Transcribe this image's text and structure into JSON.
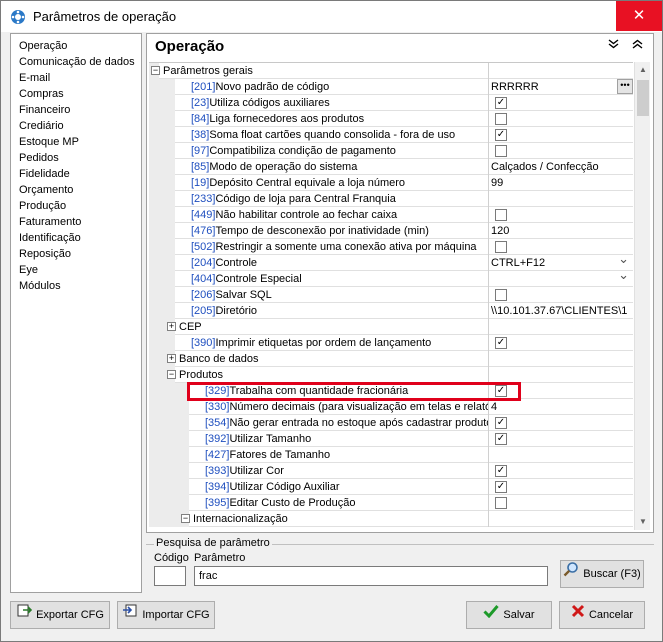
{
  "window": {
    "title": "Parâmetros de operação"
  },
  "nav": [
    "Operação",
    "Comunicação de dados",
    "E-mail",
    "Compras",
    "Financeiro",
    "Crediário",
    "Estoque MP",
    "Pedidos",
    "Fidelidade",
    "Orçamento",
    "Produção",
    "Faturamento",
    "Identificação",
    "Reposição",
    "Eye",
    "Módulos"
  ],
  "panel": {
    "title": "Operação"
  },
  "rows": [
    {
      "level": 0,
      "expander": "minus",
      "name": "Parâmetros gerais",
      "group": true
    },
    {
      "level": 1,
      "code": "[201]",
      "name": "Novo padrão de código",
      "value": "RRRRRR",
      "type": "ellipsis"
    },
    {
      "level": 1,
      "code": "[23]",
      "name": "Utiliza códigos auxiliares",
      "check": "✓",
      "type": "check"
    },
    {
      "level": 1,
      "code": "[84]",
      "name": "Liga fornecedores aos produtos",
      "check": "",
      "type": "check"
    },
    {
      "level": 1,
      "code": "[38]",
      "name": "Soma float cartões quando consolida - fora de uso",
      "check": "✓",
      "type": "check"
    },
    {
      "level": 1,
      "code": "[97]",
      "name": "Compatibiliza condição de pagamento",
      "check": "",
      "type": "check"
    },
    {
      "level": 1,
      "code": "[85]",
      "name": "Modo de operação do sistema",
      "value": "Calçados / Confecção",
      "type": "text"
    },
    {
      "level": 1,
      "code": "[19]",
      "name": "Depósito Central equivale a loja número",
      "value": "99",
      "type": "text"
    },
    {
      "level": 1,
      "code": "[233]",
      "name": "Código de loja para Central Franquia",
      "value": "",
      "type": "text"
    },
    {
      "level": 1,
      "code": "[449]",
      "name": "Não habilitar controle ao fechar caixa",
      "check": "",
      "type": "check"
    },
    {
      "level": 1,
      "code": "[476]",
      "name": "Tempo de desconexão por inatividade (min)",
      "value": "120",
      "type": "text"
    },
    {
      "level": 1,
      "code": "[502]",
      "name": "Restringir a somente uma conexão ativa por máquina",
      "check": "",
      "type": "check"
    },
    {
      "level": 1,
      "code": "[204]",
      "name": "Controle",
      "value": "CTRL+F12",
      "type": "dropdown"
    },
    {
      "level": 1,
      "code": "[404]",
      "name": "Controle Especial",
      "value": "",
      "type": "dropdown"
    },
    {
      "level": 1,
      "code": "[206]",
      "name": "Salvar SQL",
      "check": "",
      "type": "check"
    },
    {
      "level": 1,
      "code": "[205]",
      "name": "Diretório",
      "value": "\\\\10.101.37.67\\CLIENTES\\1",
      "type": "text"
    },
    {
      "level": 1,
      "expander": "plus",
      "name": "CEP",
      "group": true
    },
    {
      "level": 1,
      "code": "[390]",
      "name": "Imprimir etiquetas por ordem de lançamento",
      "check": "✓",
      "type": "check"
    },
    {
      "level": 1,
      "expander": "plus",
      "name": "Banco de dados",
      "group": true
    },
    {
      "level": 1,
      "expander": "minus",
      "name": "Produtos",
      "group": true
    },
    {
      "level": 2,
      "code": "[329]",
      "name": "Trabalha com quantidade fracionária",
      "check": "✓",
      "type": "check"
    },
    {
      "level": 2,
      "code": "[330]",
      "name": "Número decimais (para visualização em telas e relatórios)",
      "value": "4",
      "type": "text"
    },
    {
      "level": 2,
      "code": "[354]",
      "name": "Não gerar entrada no estoque após cadastrar produto",
      "check": "✓",
      "type": "check"
    },
    {
      "level": 2,
      "code": "[392]",
      "name": "Utilizar Tamanho",
      "check": "✓",
      "type": "check"
    },
    {
      "level": 2,
      "code": "[427]",
      "name": "Fatores de Tamanho",
      "value": "",
      "type": "text"
    },
    {
      "level": 2,
      "code": "[393]",
      "name": "Utilizar Cor",
      "check": "✓",
      "type": "check"
    },
    {
      "level": 2,
      "code": "[394]",
      "name": "Utilizar Código Auxiliar",
      "check": "✓",
      "type": "check"
    },
    {
      "level": 2,
      "code": "[395]",
      "name": "Editar Custo de Produção",
      "check": "",
      "type": "check"
    },
    {
      "level": 2,
      "expander": "minus",
      "name": "Internacionalização",
      "group": true
    }
  ],
  "search": {
    "legend": "Pesquisa de parâmetro",
    "code_label": "Código",
    "param_label": "Parâmetro",
    "code_value": "",
    "param_value": "frac",
    "button_label": "Buscar (F3)"
  },
  "buttons": {
    "export_label": "Exportar CFG",
    "import_label": "Importar CFG",
    "save_label": "Salvar",
    "cancel_label": "Cancelar"
  }
}
